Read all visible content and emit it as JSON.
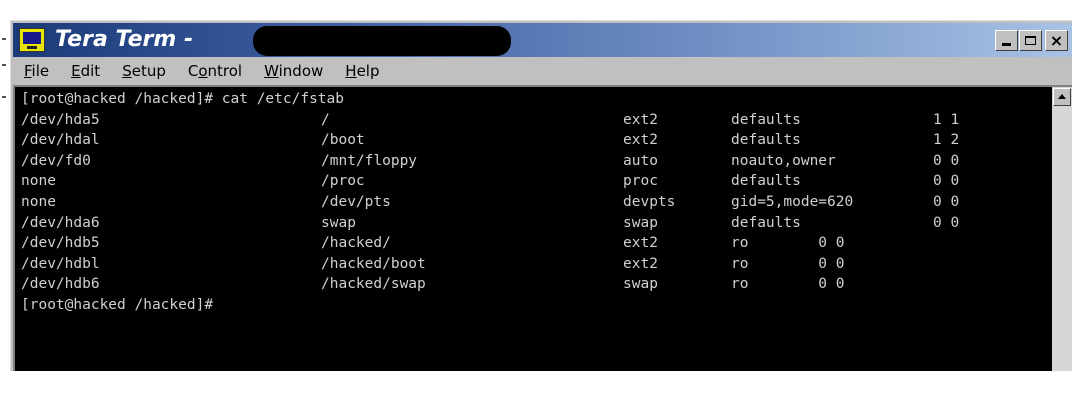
{
  "window": {
    "title": "Tera Term - ",
    "controls": {
      "minimize": "_",
      "maximize": "□",
      "close": "×"
    }
  },
  "menu": [
    {
      "label": "File",
      "key": "F",
      "rest": "ile"
    },
    {
      "label": "Edit",
      "key": "E",
      "rest": "dit"
    },
    {
      "label": "Setup",
      "key": "S",
      "rest": "etup"
    },
    {
      "label": "Control",
      "pre": "C",
      "key": "o",
      "rest": "ntrol"
    },
    {
      "label": "Window",
      "key": "W",
      "rest": "indow"
    },
    {
      "label": "Help",
      "key": "H",
      "rest": "elp"
    }
  ],
  "terminal": {
    "command_line": "[root@hacked /hacked]# cat /etc/fstab",
    "fstab": [
      {
        "device": "/dev/hda5",
        "mount": "/",
        "type": "ext2",
        "options": "defaults",
        "dump_pass": "1 1"
      },
      {
        "device": "/dev/hdal",
        "mount": "/boot",
        "type": "ext2",
        "options": "defaults",
        "dump_pass": "1 2"
      },
      {
        "device": "/dev/fd0",
        "mount": "/mnt/floppy",
        "type": "auto",
        "options": "noauto,owner",
        "dump_pass": "0 0"
      },
      {
        "device": "none",
        "mount": "/proc",
        "type": "proc",
        "options": "defaults",
        "dump_pass": "0 0"
      },
      {
        "device": "none",
        "mount": "/dev/pts",
        "type": "devpts",
        "options": "gid=5,mode=620",
        "dump_pass": "0 0"
      },
      {
        "device": "/dev/hda6",
        "mount": "swap",
        "type": "swap",
        "options": "defaults",
        "dump_pass": "0 0"
      },
      {
        "device": "/dev/hdb5",
        "mount": "/hacked/",
        "type": "ext2",
        "options": "ro        0 0",
        "dump_pass": ""
      },
      {
        "device": "/dev/hdbl",
        "mount": "/hacked/boot",
        "type": "ext2",
        "options": "ro        0 0",
        "dump_pass": ""
      },
      {
        "device": "/dev/hdb6",
        "mount": "/hacked/swap",
        "type": "swap",
        "options": "ro        0 0",
        "dump_pass": ""
      }
    ],
    "prompt": "[root@hacked /hacked]#"
  }
}
